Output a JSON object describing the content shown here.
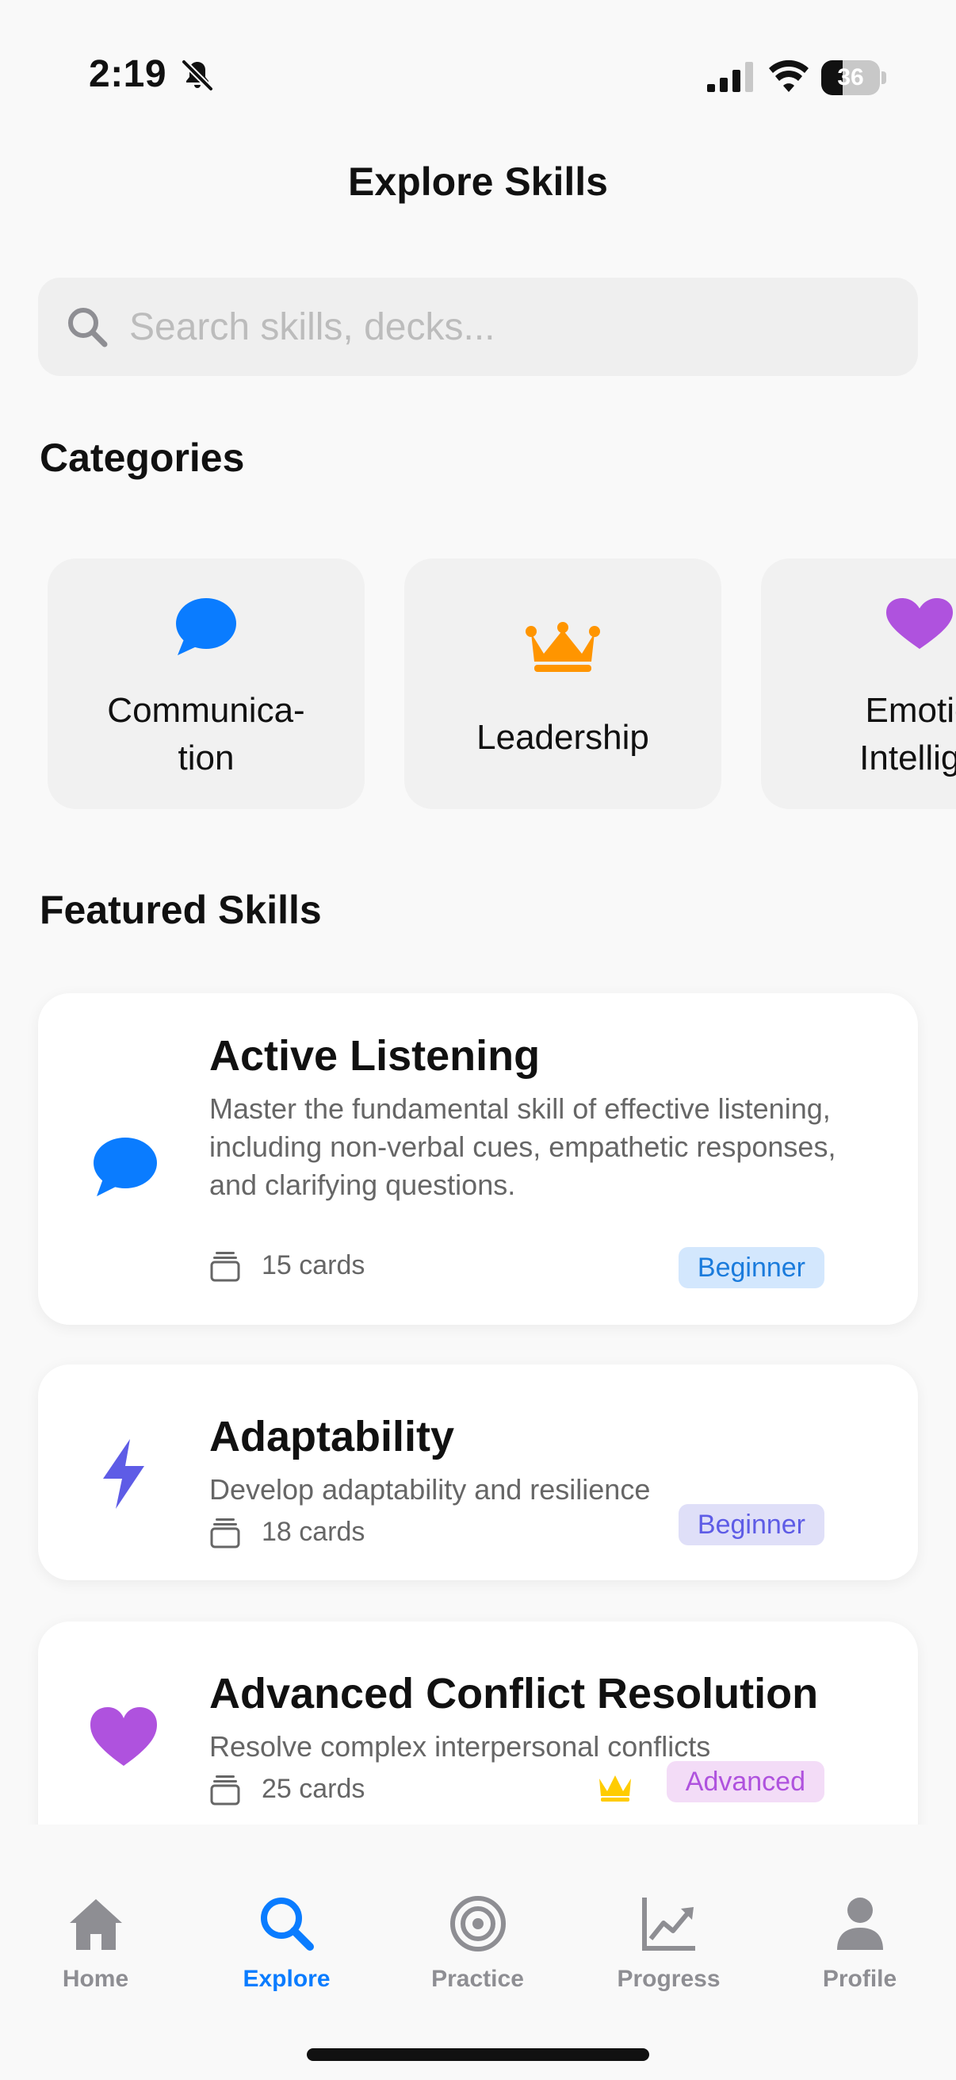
{
  "status_bar": {
    "time": "2:19",
    "battery_level": "36",
    "icons": [
      "bell-slash-icon",
      "signal-icon",
      "wifi-icon",
      "battery-icon"
    ]
  },
  "header": {
    "title": "Explore Skills"
  },
  "search": {
    "placeholder": "Search skills, decks...",
    "value": "",
    "icon": "search-icon"
  },
  "categories": {
    "title": "Categories",
    "items": [
      {
        "label_line1": "Communica-",
        "label_line2": "tion",
        "icon": "speech-bubble-icon",
        "color": "#0a7cff"
      },
      {
        "label": "Leadership",
        "icon": "crown-icon",
        "color": "#ff9500"
      },
      {
        "label_line1": "Emotio",
        "label_line2": "Intellige",
        "icon": "heart-icon",
        "color": "#af52de"
      }
    ]
  },
  "featured": {
    "title": "Featured Skills",
    "items": [
      {
        "title": "Active Listening",
        "description": "Master the fundamental skill of effective listening, including non-verbal cues, empathetic responses, and clarifying questions.",
        "cards": "15 cards",
        "level": "Beginner",
        "icon": "speech-bubble-icon",
        "icon_color": "#0a7cff",
        "badge_bg": "#d3e7fd",
        "badge_color": "#1a7bdc"
      },
      {
        "title": "Adaptability",
        "description": "Develop adaptability and resilience",
        "cards": "18 cards",
        "level": "Beginner",
        "icon": "lightning-bolt-icon",
        "icon_color": "#5e5ce6",
        "badge_bg": "#dfdff8",
        "badge_color": "#5e5ce6"
      },
      {
        "title": "Advanced Conflict Resolution",
        "description": "Resolve complex interpersonal conflicts",
        "cards": "25 cards",
        "level": "Advanced",
        "icon": "heart-icon",
        "icon_color": "#af52de",
        "badge_bg": "#f3dcf7",
        "badge_color": "#af52de",
        "premium_icon": "crown-icon",
        "premium_color": "#ffcc00"
      }
    ]
  },
  "tabs": [
    {
      "label": "Home",
      "icon": "house-icon",
      "active": false
    },
    {
      "label": "Explore",
      "icon": "search-icon",
      "active": true
    },
    {
      "label": "Practice",
      "icon": "target-icon",
      "active": false
    },
    {
      "label": "Progress",
      "icon": "chart-line-icon",
      "active": false
    },
    {
      "label": "Profile",
      "icon": "person-icon",
      "active": false
    }
  ],
  "colors": {
    "accent": "#0a7cff",
    "inactive": "#8e8e93"
  }
}
